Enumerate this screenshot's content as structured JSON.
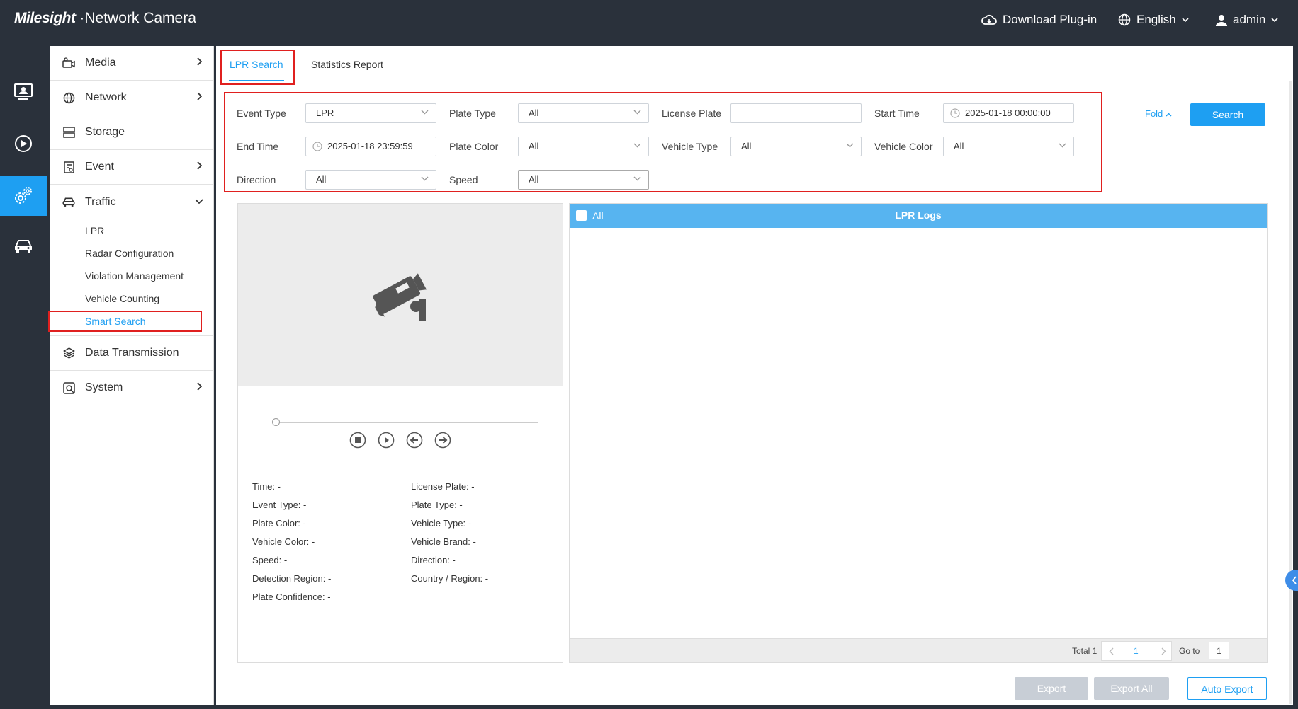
{
  "header": {
    "brand": "Milesight",
    "product": "Network Camera",
    "download_plugin": "Download Plug-in",
    "language": "English",
    "user": "admin"
  },
  "iconbar": [
    "live-view-icon",
    "playback-icon",
    "settings-icon",
    "vehicle-icon"
  ],
  "sidebar": {
    "items": [
      {
        "label": "Media",
        "icon": "camera-icon"
      },
      {
        "label": "Network",
        "icon": "globe-icon"
      },
      {
        "label": "Storage",
        "icon": "storage-icon"
      },
      {
        "label": "Event",
        "icon": "event-icon"
      },
      {
        "label": "Traffic",
        "icon": "car-icon"
      }
    ],
    "traffic_sub": [
      "LPR",
      "Radar Configuration",
      "Violation Management",
      "Vehicle Counting",
      "Smart Search"
    ],
    "items_after": [
      {
        "label": "Data Transmission",
        "icon": "layers-icon"
      },
      {
        "label": "System",
        "icon": "system-icon"
      }
    ]
  },
  "tabs": [
    "LPR Search",
    "Statistics Report"
  ],
  "filters": {
    "event_type_label": "Event Type",
    "event_type": "LPR",
    "plate_type_label": "Plate Type",
    "plate_type": "All",
    "license_plate_label": "License Plate",
    "license_plate": "",
    "start_time_label": "Start Time",
    "start_time": "2025-01-18 00:00:00",
    "end_time_label": "End Time",
    "end_time": "2025-01-18 23:59:59",
    "plate_color_label": "Plate Color",
    "plate_color": "All",
    "vehicle_type_label": "Vehicle Type",
    "vehicle_type": "All",
    "vehicle_color_label": "Vehicle Color",
    "vehicle_color": "All",
    "direction_label": "Direction",
    "direction": "All",
    "speed_label": "Speed",
    "speed": "All",
    "fold": "Fold",
    "search": "Search"
  },
  "details": {
    "left": [
      "Time: -",
      "Event Type: -",
      "Plate Color: -",
      "Vehicle Color: -",
      "Speed: -",
      "Detection Region: -",
      "Plate Confidence: -"
    ],
    "right": [
      "License Plate: -",
      "Plate Type: -",
      "Vehicle Type: -",
      "Vehicle Brand: -",
      "Direction: -",
      "Country / Region: -"
    ]
  },
  "logs": {
    "select_all": "All",
    "title": "LPR Logs",
    "total": "Total 1",
    "page": "1",
    "goto_label": "Go to",
    "goto_value": "1"
  },
  "actions": {
    "export": "Export",
    "export_all": "Export All",
    "auto_export": "Auto Export"
  },
  "colors": {
    "accent": "#1e9ff2",
    "topbar": "#2a313b",
    "highlight": "#e0201f",
    "logs_header": "#57b4f0"
  }
}
